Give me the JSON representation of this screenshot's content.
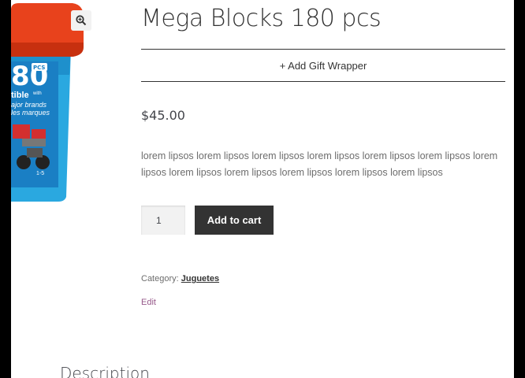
{
  "product": {
    "title": "Mega Blocks 180 pcs",
    "gift_wrapper_label": "+ Add Gift Wrapper",
    "price": "$45.00",
    "description": "lorem lipsos lorem lipsos lorem lipsos lorem lipsos lorem lipsos lorem lipsos lorem lipsos lorem lipsos lorem lipsos lorem lipsos lorem lipsos lorem lipsos",
    "quantity": "1",
    "add_to_cart_label": "Add to cart",
    "category_label": "Category:",
    "category_value": "Juguetes",
    "edit_label": "Edit",
    "image": {
      "box_number": "80",
      "box_badge": "PCS",
      "box_text_1": "tible",
      "box_text_2": "with",
      "box_text_3": "ajor brands",
      "box_text_4": "les marques",
      "box_age": "1-5"
    }
  },
  "tabs": {
    "description_label": "Description"
  },
  "icons": {
    "zoom": "zoom-in-icon"
  }
}
